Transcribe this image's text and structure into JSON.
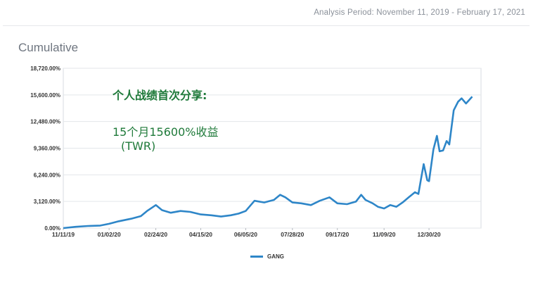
{
  "header": {
    "period": "Analysis Period: November 11, 2019 - February 17, 2021",
    "section_title": "Cumulative"
  },
  "annotation": {
    "title": "个人战绩首次分享:",
    "line1": "15个月15600%收益",
    "line2": "(TWR)"
  },
  "colors": {
    "series": "#2e86c8",
    "annotation": "#1f7a3a"
  },
  "chart_data": {
    "type": "line",
    "title": "",
    "xlabel": "",
    "ylabel": "",
    "ylim": [
      0,
      18720
    ],
    "y_ticks": [
      "0.00%",
      "3,120.00%",
      "6,240.00%",
      "9,360.00%",
      "12,480.00%",
      "15,600.00%",
      "18,720.00%"
    ],
    "x_ticks": [
      "11/11/19",
      "01/02/20",
      "02/24/20",
      "04/15/20",
      "06/05/20",
      "07/28/20",
      "09/17/20",
      "11/09/20",
      "12/30/20"
    ],
    "grid": true,
    "legend": "bottom",
    "series": [
      {
        "name": "GANG",
        "x": [
          "2019-11-11",
          "2019-11-25",
          "2019-12-09",
          "2019-12-23",
          "2020-01-02",
          "2020-01-13",
          "2020-01-27",
          "2020-02-07",
          "2020-02-14",
          "2020-02-24",
          "2020-03-02",
          "2020-03-12",
          "2020-03-23",
          "2020-04-03",
          "2020-04-15",
          "2020-04-27",
          "2020-05-08",
          "2020-05-19",
          "2020-05-28",
          "2020-06-05",
          "2020-06-15",
          "2020-06-26",
          "2020-07-07",
          "2020-07-14",
          "2020-07-20",
          "2020-07-28",
          "2020-08-07",
          "2020-08-18",
          "2020-08-28",
          "2020-09-08",
          "2020-09-17",
          "2020-09-28",
          "2020-10-08",
          "2020-10-14",
          "2020-10-19",
          "2020-10-27",
          "2020-11-02",
          "2020-11-09",
          "2020-11-16",
          "2020-11-23",
          "2020-11-30",
          "2020-12-07",
          "2020-12-14",
          "2020-12-18",
          "2020-12-21",
          "2020-12-24",
          "2020-12-28",
          "2020-12-30",
          "2021-01-04",
          "2021-01-08",
          "2021-01-11",
          "2021-01-15",
          "2021-01-19",
          "2021-01-22",
          "2021-01-27",
          "2021-02-01",
          "2021-02-05",
          "2021-02-10",
          "2021-02-17"
        ],
        "y": [
          0,
          150,
          250,
          300,
          500,
          800,
          1100,
          1400,
          2000,
          2700,
          2100,
          1800,
          2000,
          1900,
          1600,
          1500,
          1350,
          1500,
          1700,
          2000,
          3200,
          3000,
          3300,
          3900,
          3600,
          3000,
          2900,
          2700,
          3200,
          3600,
          2900,
          2800,
          3100,
          3900,
          3300,
          2900,
          2500,
          2300,
          2700,
          2500,
          3000,
          3600,
          4200,
          4000,
          5800,
          7500,
          5600,
          5500,
          9200,
          10800,
          9000,
          9100,
          10200,
          9800,
          13800,
          14800,
          15200,
          14600,
          15400
        ]
      }
    ]
  }
}
